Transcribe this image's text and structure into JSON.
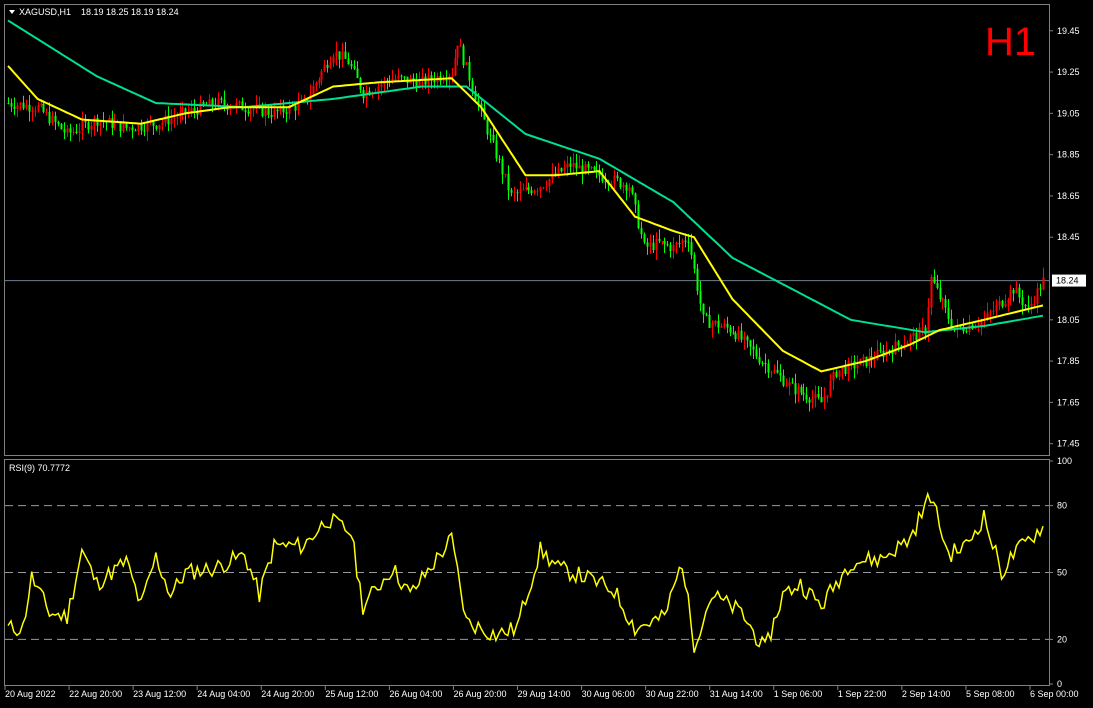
{
  "chart_data": [
    {
      "type": "candlestick",
      "symbol_header": "XAGUSD,H1",
      "ohlc_header": "18.19 18.25 18.19 18.24",
      "timeframe_label": "H1",
      "last_price_label": "18.24",
      "last_price": 18.24,
      "ylim": [
        17.4,
        19.57
      ],
      "yticks": [
        19.45,
        19.25,
        19.05,
        18.85,
        18.65,
        18.45,
        18.24,
        18.05,
        17.85,
        17.65,
        17.45
      ],
      "ytick_labels": [
        "19.45",
        "19.25",
        "19.05",
        "18.85",
        "18.65",
        "18.45",
        "18.24",
        "18.05",
        "17.85",
        "17.65",
        "17.45"
      ],
      "xtick_labels": [
        "20 Aug 2022",
        "22 Aug 20:00",
        "23 Aug 12:00",
        "24 Aug 04:00",
        "24 Aug 20:00",
        "25 Aug 12:00",
        "26 Aug 04:00",
        "26 Aug 20:00",
        "29 Aug 14:00",
        "30 Aug 06:00",
        "30 Aug 22:00",
        "31 Aug 14:00",
        "1 Sep 06:00",
        "1 Sep 22:00",
        "2 Sep 14:00",
        "5 Sep 08:00",
        "6 Sep 00:00"
      ],
      "close_anchors": [
        [
          0,
          19.1
        ],
        [
          10,
          19.08
        ],
        [
          20,
          18.95
        ],
        [
          30,
          19.02
        ],
        [
          40,
          18.98
        ],
        [
          50,
          19.0
        ],
        [
          60,
          19.05
        ],
        [
          70,
          19.1
        ],
        [
          80,
          19.08
        ],
        [
          90,
          19.05
        ],
        [
          100,
          19.1
        ],
        [
          110,
          19.35
        ],
        [
          115,
          19.3
        ],
        [
          120,
          19.15
        ],
        [
          130,
          19.22
        ],
        [
          140,
          19.2
        ],
        [
          150,
          19.25
        ],
        [
          152,
          19.4
        ],
        [
          160,
          19.05
        ],
        [
          170,
          18.65
        ],
        [
          180,
          18.7
        ],
        [
          190,
          18.8
        ],
        [
          200,
          18.75
        ],
        [
          210,
          18.7
        ],
        [
          215,
          18.4
        ],
        [
          220,
          18.42
        ],
        [
          225,
          18.4
        ],
        [
          230,
          18.45
        ],
        [
          235,
          18.05
        ],
        [
          245,
          18.0
        ],
        [
          255,
          17.85
        ],
        [
          265,
          17.72
        ],
        [
          275,
          17.65
        ],
        [
          280,
          17.8
        ],
        [
          290,
          17.85
        ],
        [
          300,
          17.92
        ],
        [
          310,
          18.0
        ],
        [
          312,
          18.25
        ],
        [
          320,
          18.0
        ],
        [
          330,
          18.05
        ],
        [
          340,
          18.2
        ],
        [
          345,
          18.1
        ],
        [
          350,
          18.24
        ]
      ],
      "ma_fast_anchors": [
        [
          0,
          19.28
        ],
        [
          10,
          19.12
        ],
        [
          25,
          19.02
        ],
        [
          45,
          19.0
        ],
        [
          60,
          19.05
        ],
        [
          75,
          19.08
        ],
        [
          95,
          19.08
        ],
        [
          110,
          19.18
        ],
        [
          125,
          19.2
        ],
        [
          150,
          19.22
        ],
        [
          160,
          19.08
        ],
        [
          175,
          18.75
        ],
        [
          185,
          18.75
        ],
        [
          200,
          18.77
        ],
        [
          212,
          18.55
        ],
        [
          225,
          18.48
        ],
        [
          232,
          18.45
        ],
        [
          245,
          18.15
        ],
        [
          262,
          17.9
        ],
        [
          275,
          17.8
        ],
        [
          290,
          17.85
        ],
        [
          305,
          17.93
        ],
        [
          315,
          18.0
        ],
        [
          330,
          18.05
        ],
        [
          350,
          18.12
        ]
      ],
      "ma_slow_anchors": [
        [
          0,
          19.5
        ],
        [
          30,
          19.23
        ],
        [
          50,
          19.1
        ],
        [
          80,
          19.08
        ],
        [
          110,
          19.12
        ],
        [
          140,
          19.18
        ],
        [
          155,
          19.18
        ],
        [
          175,
          18.95
        ],
        [
          200,
          18.83
        ],
        [
          225,
          18.62
        ],
        [
          245,
          18.35
        ],
        [
          265,
          18.2
        ],
        [
          285,
          18.05
        ],
        [
          310,
          17.99
        ],
        [
          330,
          18.02
        ],
        [
          350,
          18.07
        ]
      ],
      "ma_fast_color": "#ffff00",
      "ma_slow_color": "#00e090",
      "candle_up_color": "#ff0000",
      "candle_down_color": "#00ff00",
      "grid": false
    },
    {
      "type": "line",
      "header": "RSI(9) 70.7772",
      "ylim": [
        0,
        100
      ],
      "yticks": [
        100,
        80,
        50,
        20,
        0
      ],
      "ytick_labels": [
        "100",
        "80",
        "50",
        "20",
        "0"
      ],
      "levels": [
        80,
        50,
        20
      ],
      "rsi_anchors": [
        [
          0,
          25
        ],
        [
          5,
          25
        ],
        [
          8,
          48
        ],
        [
          14,
          32
        ],
        [
          20,
          30
        ],
        [
          25,
          60
        ],
        [
          30,
          45
        ],
        [
          40,
          55
        ],
        [
          45,
          35
        ],
        [
          50,
          57
        ],
        [
          55,
          40
        ],
        [
          60,
          50
        ],
        [
          70,
          52
        ],
        [
          80,
          58
        ],
        [
          85,
          40
        ],
        [
          90,
          62
        ],
        [
          100,
          62
        ],
        [
          108,
          74
        ],
        [
          116,
          68
        ],
        [
          120,
          35
        ],
        [
          130,
          52
        ],
        [
          136,
          40
        ],
        [
          150,
          65
        ],
        [
          155,
          28
        ],
        [
          165,
          22
        ],
        [
          172,
          25
        ],
        [
          180,
          60
        ],
        [
          186,
          52
        ],
        [
          195,
          48
        ],
        [
          205,
          42
        ],
        [
          212,
          25
        ],
        [
          222,
          30
        ],
        [
          228,
          55
        ],
        [
          232,
          18
        ],
        [
          238,
          40
        ],
        [
          248,
          32
        ],
        [
          256,
          15
        ],
        [
          262,
          40
        ],
        [
          268,
          45
        ],
        [
          275,
          35
        ],
        [
          285,
          55
        ],
        [
          295,
          56
        ],
        [
          305,
          65
        ],
        [
          312,
          85
        ],
        [
          318,
          58
        ],
        [
          324,
          62
        ],
        [
          330,
          75
        ],
        [
          336,
          50
        ],
        [
          340,
          58
        ],
        [
          350,
          70.78
        ]
      ],
      "line_color": "#ffff00",
      "grid": false
    }
  ]
}
